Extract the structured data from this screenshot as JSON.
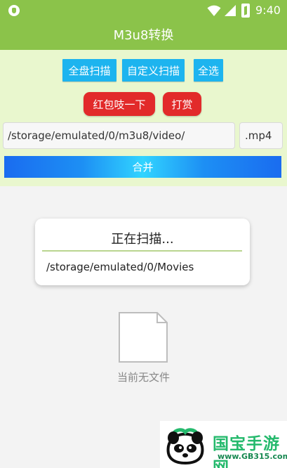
{
  "status_bar": {
    "time": "9:40",
    "left_icon": "shield-icon",
    "wifi_icon": "wifi-icon",
    "signal_icon": "signal-icon",
    "battery_icon": "battery-charging-icon"
  },
  "app_bar": {
    "title": "M3u8转换"
  },
  "top_buttons": {
    "full_scan": "全盘扫描",
    "custom_scan": "自定义扫描",
    "select_all": "全选",
    "red_packet": "红包吱一下",
    "reward": "打赏"
  },
  "inputs": {
    "path": "/storage/emulated/0/m3u8/video/",
    "extension": ".mp4"
  },
  "merge": {
    "label": "合并"
  },
  "scanning": {
    "title": "正在扫描...",
    "path": "/storage/emulated/0/Movies"
  },
  "empty_state": {
    "icon": "file-icon",
    "text": "当前无文件"
  },
  "watermark": {
    "brand": "国宝手游网",
    "url": "www.GB315.com",
    "logo_icon": "panda-icon"
  },
  "colors": {
    "primary_green": "#8bc34a",
    "panel_green": "#e9f7ce",
    "blue_button": "#1db4ef",
    "red_button": "#e22a2a",
    "merge_gradient_start": "#1a6cf0",
    "merge_gradient_center": "#31d4ff"
  }
}
